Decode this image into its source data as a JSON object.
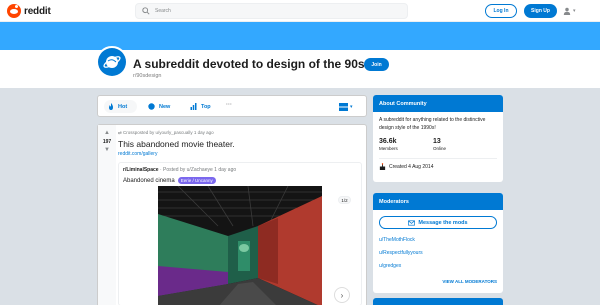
{
  "header": {
    "logo_text": "reddit",
    "search_placeholder": "Search",
    "login_label": "Log In",
    "signup_label": "Sign Up"
  },
  "subreddit": {
    "title": "A subreddit devoted to design of the 90s",
    "name": "r/90sdesign",
    "join_label": "Join"
  },
  "sort": {
    "hot": "Hot",
    "new": "New",
    "top": "Top",
    "more": "···"
  },
  "post": {
    "votes": "197",
    "meta": "Crossposted by u/yourly_pascually 1 day ago",
    "title": "This abandoned movie theater.",
    "link": "reddit.com/gallery",
    "embed": {
      "sub": "r/LiminalSpace",
      "by": " · Posted by u/Zachaeye 1 day ago",
      "title": "Abandoned cinema",
      "flair": "Eerie / Uncanny",
      "counter": "1/2"
    }
  },
  "about": {
    "heading": "About Community",
    "description": "A subreddit for anything related to the distinctive design style of the 1990s!",
    "members_num": "36.6k",
    "members_label": "Members",
    "online_num": "13",
    "online_label": "Online",
    "created": "Created 4 Aug 2014"
  },
  "moderators": {
    "heading": "Moderators",
    "message_label": "Message the mods",
    "list": [
      "u/TheMothFlock",
      "u/Respectfullyyours",
      "u/gredgex"
    ],
    "view_all": "VIEW ALL MODERATORS"
  },
  "colors": {
    "accent": "#0079d3",
    "banner": "#33a8ff",
    "brand": "#ff4500"
  }
}
